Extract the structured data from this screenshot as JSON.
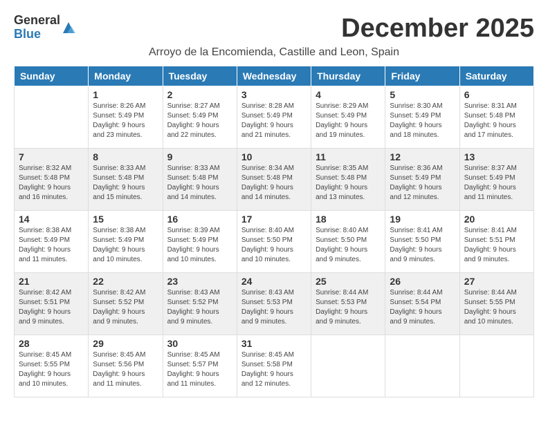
{
  "logo": {
    "general": "General",
    "blue": "Blue"
  },
  "title": "December 2025",
  "location": "Arroyo de la Encomienda, Castille and Leon, Spain",
  "headers": [
    "Sunday",
    "Monday",
    "Tuesday",
    "Wednesday",
    "Thursday",
    "Friday",
    "Saturday"
  ],
  "weeks": [
    [
      {
        "day": "",
        "sunrise": "",
        "sunset": "",
        "daylight": ""
      },
      {
        "day": "1",
        "sunrise": "Sunrise: 8:26 AM",
        "sunset": "Sunset: 5:49 PM",
        "daylight": "Daylight: 9 hours and 23 minutes."
      },
      {
        "day": "2",
        "sunrise": "Sunrise: 8:27 AM",
        "sunset": "Sunset: 5:49 PM",
        "daylight": "Daylight: 9 hours and 22 minutes."
      },
      {
        "day": "3",
        "sunrise": "Sunrise: 8:28 AM",
        "sunset": "Sunset: 5:49 PM",
        "daylight": "Daylight: 9 hours and 21 minutes."
      },
      {
        "day": "4",
        "sunrise": "Sunrise: 8:29 AM",
        "sunset": "Sunset: 5:49 PM",
        "daylight": "Daylight: 9 hours and 19 minutes."
      },
      {
        "day": "5",
        "sunrise": "Sunrise: 8:30 AM",
        "sunset": "Sunset: 5:49 PM",
        "daylight": "Daylight: 9 hours and 18 minutes."
      },
      {
        "day": "6",
        "sunrise": "Sunrise: 8:31 AM",
        "sunset": "Sunset: 5:48 PM",
        "daylight": "Daylight: 9 hours and 17 minutes."
      }
    ],
    [
      {
        "day": "7",
        "sunrise": "Sunrise: 8:32 AM",
        "sunset": "Sunset: 5:48 PM",
        "daylight": "Daylight: 9 hours and 16 minutes."
      },
      {
        "day": "8",
        "sunrise": "Sunrise: 8:33 AM",
        "sunset": "Sunset: 5:48 PM",
        "daylight": "Daylight: 9 hours and 15 minutes."
      },
      {
        "day": "9",
        "sunrise": "Sunrise: 8:33 AM",
        "sunset": "Sunset: 5:48 PM",
        "daylight": "Daylight: 9 hours and 14 minutes."
      },
      {
        "day": "10",
        "sunrise": "Sunrise: 8:34 AM",
        "sunset": "Sunset: 5:48 PM",
        "daylight": "Daylight: 9 hours and 14 minutes."
      },
      {
        "day": "11",
        "sunrise": "Sunrise: 8:35 AM",
        "sunset": "Sunset: 5:48 PM",
        "daylight": "Daylight: 9 hours and 13 minutes."
      },
      {
        "day": "12",
        "sunrise": "Sunrise: 8:36 AM",
        "sunset": "Sunset: 5:49 PM",
        "daylight": "Daylight: 9 hours and 12 minutes."
      },
      {
        "day": "13",
        "sunrise": "Sunrise: 8:37 AM",
        "sunset": "Sunset: 5:49 PM",
        "daylight": "Daylight: 9 hours and 11 minutes."
      }
    ],
    [
      {
        "day": "14",
        "sunrise": "Sunrise: 8:38 AM",
        "sunset": "Sunset: 5:49 PM",
        "daylight": "Daylight: 9 hours and 11 minutes."
      },
      {
        "day": "15",
        "sunrise": "Sunrise: 8:38 AM",
        "sunset": "Sunset: 5:49 PM",
        "daylight": "Daylight: 9 hours and 10 minutes."
      },
      {
        "day": "16",
        "sunrise": "Sunrise: 8:39 AM",
        "sunset": "Sunset: 5:49 PM",
        "daylight": "Daylight: 9 hours and 10 minutes."
      },
      {
        "day": "17",
        "sunrise": "Sunrise: 8:40 AM",
        "sunset": "Sunset: 5:50 PM",
        "daylight": "Daylight: 9 hours and 10 minutes."
      },
      {
        "day": "18",
        "sunrise": "Sunrise: 8:40 AM",
        "sunset": "Sunset: 5:50 PM",
        "daylight": "Daylight: 9 hours and 9 minutes."
      },
      {
        "day": "19",
        "sunrise": "Sunrise: 8:41 AM",
        "sunset": "Sunset: 5:50 PM",
        "daylight": "Daylight: 9 hours and 9 minutes."
      },
      {
        "day": "20",
        "sunrise": "Sunrise: 8:41 AM",
        "sunset": "Sunset: 5:51 PM",
        "daylight": "Daylight: 9 hours and 9 minutes."
      }
    ],
    [
      {
        "day": "21",
        "sunrise": "Sunrise: 8:42 AM",
        "sunset": "Sunset: 5:51 PM",
        "daylight": "Daylight: 9 hours and 9 minutes."
      },
      {
        "day": "22",
        "sunrise": "Sunrise: 8:42 AM",
        "sunset": "Sunset: 5:52 PM",
        "daylight": "Daylight: 9 hours and 9 minutes."
      },
      {
        "day": "23",
        "sunrise": "Sunrise: 8:43 AM",
        "sunset": "Sunset: 5:52 PM",
        "daylight": "Daylight: 9 hours and 9 minutes."
      },
      {
        "day": "24",
        "sunrise": "Sunrise: 8:43 AM",
        "sunset": "Sunset: 5:53 PM",
        "daylight": "Daylight: 9 hours and 9 minutes."
      },
      {
        "day": "25",
        "sunrise": "Sunrise: 8:44 AM",
        "sunset": "Sunset: 5:53 PM",
        "daylight": "Daylight: 9 hours and 9 minutes."
      },
      {
        "day": "26",
        "sunrise": "Sunrise: 8:44 AM",
        "sunset": "Sunset: 5:54 PM",
        "daylight": "Daylight: 9 hours and 9 minutes."
      },
      {
        "day": "27",
        "sunrise": "Sunrise: 8:44 AM",
        "sunset": "Sunset: 5:55 PM",
        "daylight": "Daylight: 9 hours and 10 minutes."
      }
    ],
    [
      {
        "day": "28",
        "sunrise": "Sunrise: 8:45 AM",
        "sunset": "Sunset: 5:55 PM",
        "daylight": "Daylight: 9 hours and 10 minutes."
      },
      {
        "day": "29",
        "sunrise": "Sunrise: 8:45 AM",
        "sunset": "Sunset: 5:56 PM",
        "daylight": "Daylight: 9 hours and 11 minutes."
      },
      {
        "day": "30",
        "sunrise": "Sunrise: 8:45 AM",
        "sunset": "Sunset: 5:57 PM",
        "daylight": "Daylight: 9 hours and 11 minutes."
      },
      {
        "day": "31",
        "sunrise": "Sunrise: 8:45 AM",
        "sunset": "Sunset: 5:58 PM",
        "daylight": "Daylight: 9 hours and 12 minutes."
      },
      {
        "day": "",
        "sunrise": "",
        "sunset": "",
        "daylight": ""
      },
      {
        "day": "",
        "sunrise": "",
        "sunset": "",
        "daylight": ""
      },
      {
        "day": "",
        "sunrise": "",
        "sunset": "",
        "daylight": ""
      }
    ]
  ]
}
